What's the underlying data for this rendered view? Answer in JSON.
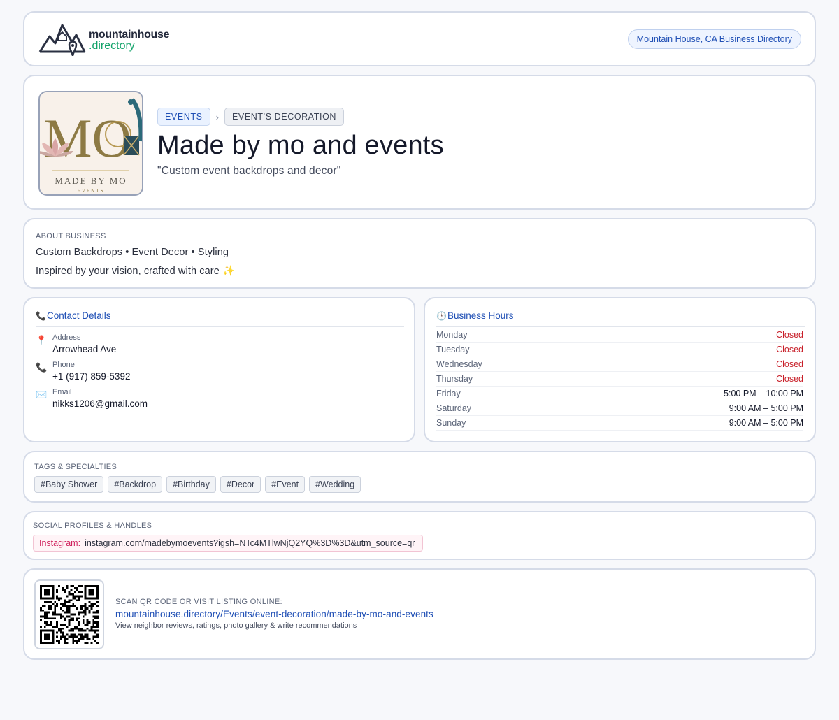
{
  "header": {
    "logo_main": "mountainhouse",
    "logo_sub": ".directory",
    "directory_pill": "Mountain House, CA Business Directory"
  },
  "hero": {
    "logo_text": "MADE BY MO",
    "logo_subtext": "EVENTS",
    "logo_monogram": "MO",
    "breadcrumbs": [
      "EVENTS",
      "EVENT'S DECORATION"
    ],
    "separator": "›",
    "title": "Made by mo and events",
    "tagline": "\"Custom event backdrops and decor\""
  },
  "about": {
    "label": "ABOUT BUSINESS",
    "line1": "Custom Backdrops • Event Decor • Styling",
    "line2": "Inspired by your vision, crafted with care ✨"
  },
  "contact": {
    "heading": "Contact Details",
    "heading_icon": "📞",
    "address_icon": "📍",
    "address_label": "Address",
    "address": "Arrowhead Ave",
    "phone_icon": "📞",
    "phone_label": "Phone",
    "phone": "+1 (917) 859-5392",
    "email_icon": "✉️",
    "email_label": "Email",
    "email": "nikks1206@gmail.com"
  },
  "hours": {
    "heading": "Business Hours",
    "heading_icon": "🕒",
    "days": [
      {
        "day": "Monday",
        "time": "Closed"
      },
      {
        "day": "Tuesday",
        "time": "Closed"
      },
      {
        "day": "Wednesday",
        "time": "Closed"
      },
      {
        "day": "Thursday",
        "time": "Closed"
      },
      {
        "day": "Friday",
        "time": "5:00 PM – 10:00 PM"
      },
      {
        "day": "Saturday",
        "time": "9:00 AM – 5:00 PM"
      },
      {
        "day": "Sunday",
        "time": "9:00 AM – 5:00 PM"
      }
    ],
    "closed_color": "#c8202a"
  },
  "tags": {
    "label": "TAGS & SPECIALTIES",
    "items": [
      "#Baby Shower",
      "#Backdrop",
      "#Birthday",
      "#Decor",
      "#Event",
      "#Wedding"
    ]
  },
  "social": {
    "label": "SOCIAL PROFILES & HANDLES",
    "network": "Instagram:",
    "url": "instagram.com/madebymoevents?igsh=NTc4MTlwNjQ2YQ%3D%3D&utm_source=qr"
  },
  "qr": {
    "label": "SCAN QR CODE OR VISIT LISTING ONLINE:",
    "url": "mountainhouse.directory/Events/event-decoration/made-by-mo-and-events",
    "note": "View neighbor reviews, ratings, photo gallery & write recommendations"
  },
  "colors": {
    "accent": "#1f4fb5",
    "brand_green": "#13a36a",
    "instagram": "#d0215d"
  }
}
